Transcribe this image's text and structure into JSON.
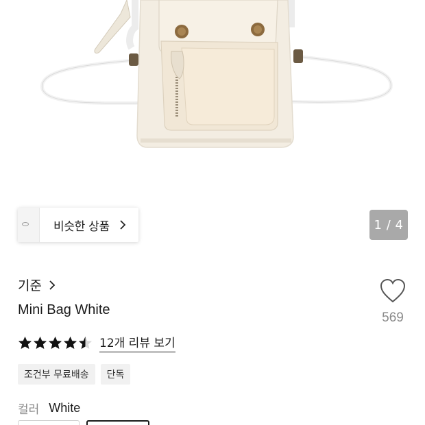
{
  "gallery": {
    "similar_label": "비슷한 상품",
    "counter": "1 / 4"
  },
  "product": {
    "brand": "기준",
    "title": "Mini Bag White",
    "like_count": "569",
    "rating": 4.5,
    "review_link": "12개 리뷰 보기",
    "badges": [
      "조건부 무료배송",
      "단독"
    ]
  },
  "options": {
    "color_label": "컬러",
    "color_value": "White"
  },
  "colors": {
    "star": "#111111",
    "counter_bg": "#a9a9a9",
    "badge_bg": "#f1f1f1"
  }
}
